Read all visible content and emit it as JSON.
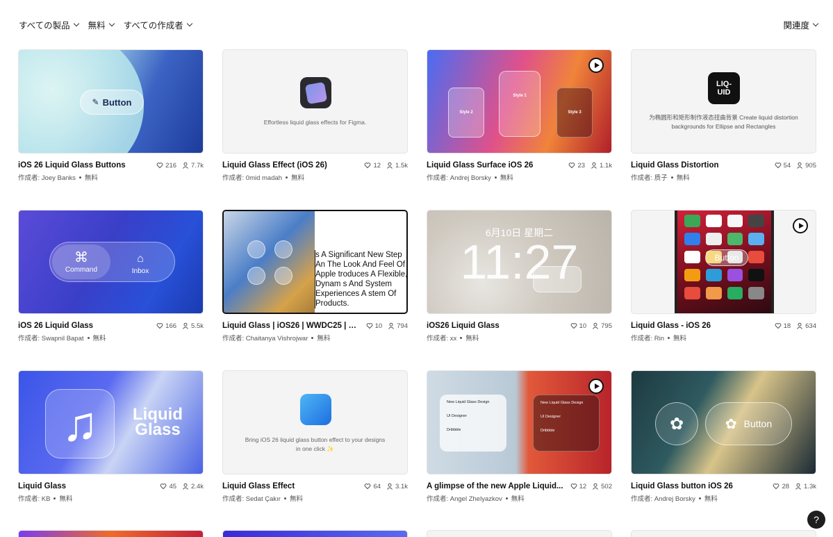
{
  "filters": {
    "products": "すべての製品",
    "price": "無料",
    "authors": "すべての作成者",
    "sort": "関連度"
  },
  "author_prefix": "作成者: ",
  "price_label": "無料",
  "help_label": "?",
  "cards": [
    {
      "title": "iOS 26 Liquid Glass Buttons",
      "author": "Joey Banks",
      "likes": "216",
      "users": "7.7k",
      "thumb_text": "Button"
    },
    {
      "title": "Liquid Glass Effect (iOS 26)",
      "author": "0mid madah",
      "likes": "12",
      "users": "1.5k",
      "thumb_text": "Effortless liquid glass effects for Figma."
    },
    {
      "title": "Liquid Glass Surface iOS 26",
      "author": "Andrej Borsky",
      "likes": "23",
      "users": "1.1k",
      "thumb_labels": [
        "Style 2",
        "Style 1",
        "Style 3"
      ]
    },
    {
      "title": "Liquid Glass Distortion",
      "author": "质子",
      "likes": "54",
      "users": "905",
      "thumb_logo": "LIQ-UID",
      "thumb_text": "为椭圆形和矩形制作液态扭曲背景 Create liquid distortion backgrounds for Ellipse and Rectangles"
    },
    {
      "title": "iOS 26 Liquid Glass",
      "author": "Swapnil Bapat",
      "likes": "166",
      "users": "5.5k",
      "thumb_labels": [
        "Command",
        "Inbox"
      ]
    },
    {
      "title": "Liquid Glass | iOS26 | WWDC25 | Clic...",
      "author": "Chaitanya Vishrojwar",
      "likes": "10",
      "users": "794",
      "thumb_text": "s A Significant New Step An The Look And Feel Of Apple troduces A Flexible, Dynam s And System Experiences A stem Of Products."
    },
    {
      "title": "iOS26 Liquid Glass",
      "author": "xx",
      "likes": "10",
      "users": "795",
      "thumb_date": "6月10日 星期二",
      "thumb_time": "11:27"
    },
    {
      "title": "Liquid Glass - iOS 26",
      "author": "Rin",
      "likes": "18",
      "users": "634",
      "thumb_text": "Button"
    },
    {
      "title": "Liquid Glass",
      "author": "KB",
      "likes": "45",
      "users": "2.4k",
      "thumb_text": "Liquid Glass"
    },
    {
      "title": "Liquid Glass Effect",
      "author": "Sedat Çakır",
      "likes": "64",
      "users": "3.1k",
      "thumb_text": "Bring iOS 26 liquid glass button effect to your designs in one click ✨"
    },
    {
      "title": "A glimpse of the new Apple Liquid...",
      "author": "Angel Zhelyazkov",
      "likes": "12",
      "users": "502",
      "thumb_labels": [
        "New Liquid Glass Design",
        "UI Designer",
        "Dribbble"
      ]
    },
    {
      "title": "Liquid Glass button iOS 26",
      "author": "Andrej Borsky",
      "likes": "28",
      "users": "1.3k",
      "thumb_text": "Button"
    }
  ]
}
